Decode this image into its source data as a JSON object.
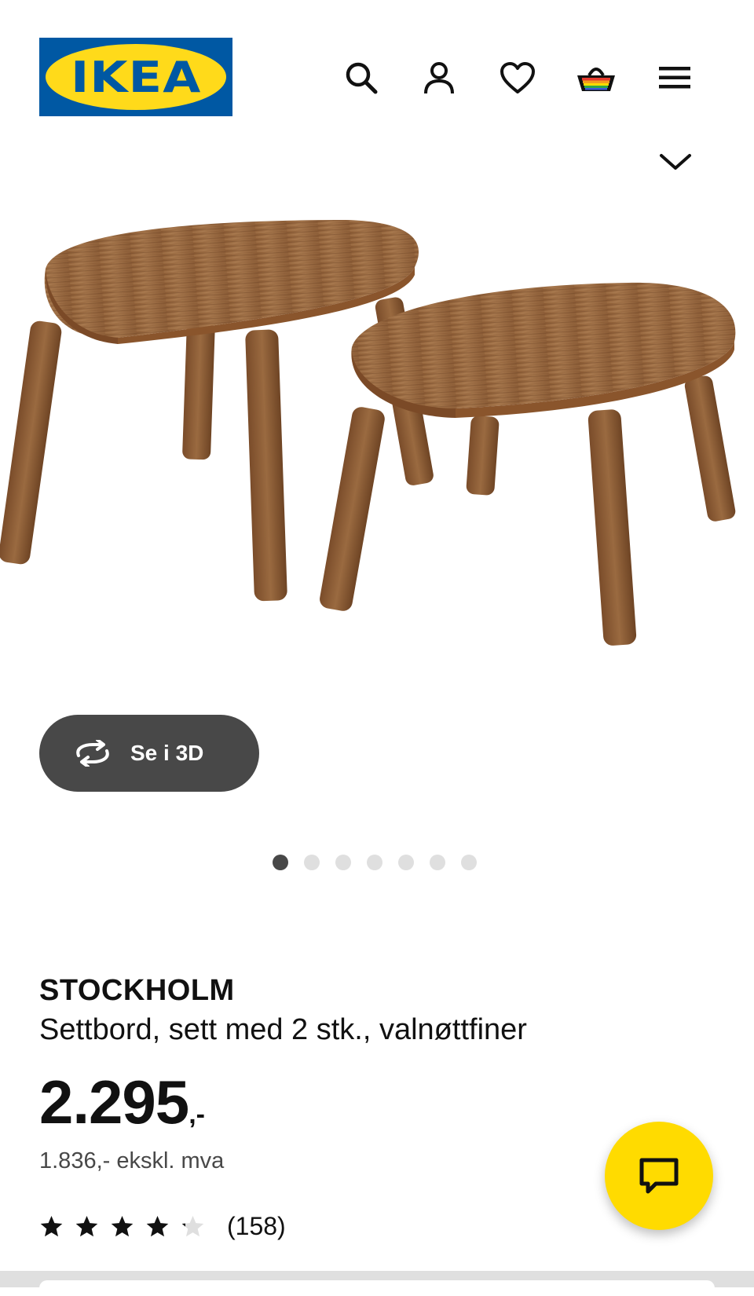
{
  "brand": {
    "logo_text": "IKEA",
    "blue": "#0058a3",
    "yellow": "#ffda1a"
  },
  "header": {
    "icons": [
      "search-icon",
      "user-icon",
      "heart-icon",
      "basket-icon",
      "menu-icon",
      "chevron-down-icon"
    ]
  },
  "gallery": {
    "view_3d_label": "Se i 3D",
    "total_images": 7,
    "active_index": 0
  },
  "product": {
    "name": "STOCKHOLM",
    "description": "Settbord, sett med 2 stk., valnøttfiner",
    "price_main": "2.295",
    "price_suffix": ",-",
    "price_ex_vat": "1.836,- ekskl. mva",
    "rating_value": 4.5,
    "rating_max": 5,
    "review_count": "(158)"
  },
  "colors": {
    "dark_button": "#484848",
    "chat_button": "#ffdb00",
    "text": "#111111"
  }
}
